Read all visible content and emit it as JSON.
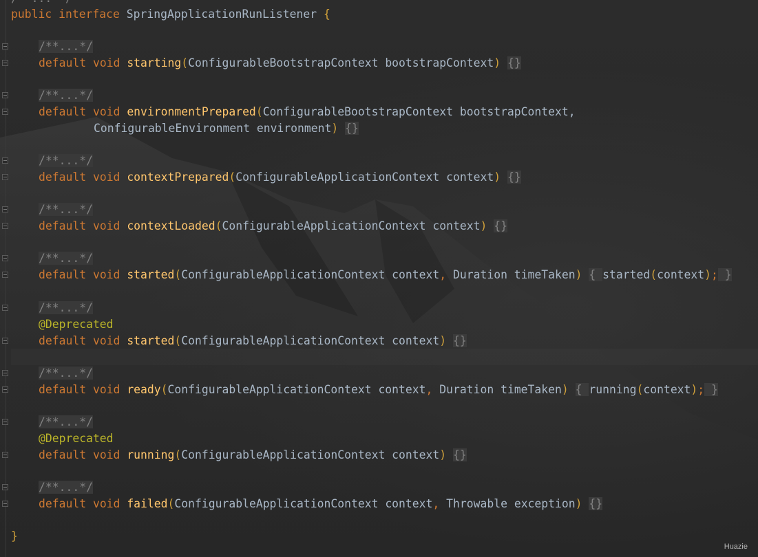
{
  "editor": {
    "theme_colors": {
      "background": "#2b2b2b",
      "keyword": "#cc7832",
      "method": "#ffc66d",
      "text": "#a9b7c6",
      "comment": "#808080",
      "annotation": "#bbb529"
    },
    "code": {
      "top_fragment": "/* ... */",
      "interface_decl": {
        "kw_public": "public",
        "kw_interface": "interface",
        "name": "SpringApplicationRunListener",
        "open_brace": "{"
      },
      "comment_fold": "/**...*/",
      "kw_default": "default",
      "kw_void": "void",
      "annotation": "@Deprecated",
      "methods": [
        {
          "name": "starting",
          "params": "ConfigurableBootstrapContext bootstrapContext",
          "body": "{}"
        },
        {
          "name": "environmentPrepared",
          "params": "ConfigurableBootstrapContext bootstrapContext,",
          "params_cont": "ConfigurableEnvironment environment",
          "body": "{}"
        },
        {
          "name": "contextPrepared",
          "params": "ConfigurableApplicationContext context",
          "body": "{}"
        },
        {
          "name": "contextLoaded",
          "params": "ConfigurableApplicationContext context",
          "body": "{}"
        },
        {
          "name": "started",
          "params_a": "ConfigurableApplicationContext context",
          "params_b": "Duration timeTaken",
          "body_open": "{",
          "body_call": "started",
          "body_arg": "context",
          "body_semi": ";",
          "body_close": "}"
        },
        {
          "name": "started",
          "params": "ConfigurableApplicationContext context",
          "body": "{}"
        },
        {
          "name": "ready",
          "params_a": "ConfigurableApplicationContext context",
          "params_b": "Duration timeTaken",
          "body_open": "{",
          "body_call": "running",
          "body_arg": "context",
          "body_semi": ";",
          "body_close": "}"
        },
        {
          "name": "running",
          "params": "ConfigurableApplicationContext context",
          "body": "{}"
        },
        {
          "name": "failed",
          "params_a": "ConfigurableApplicationContext context",
          "params_b": "Throwable exception",
          "body": "{}"
        }
      ],
      "close_brace": "}"
    },
    "watermark": "Huazie"
  }
}
